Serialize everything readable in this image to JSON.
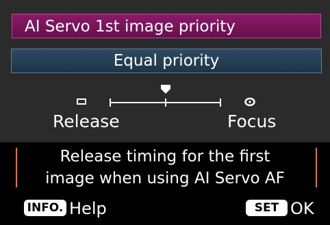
{
  "menu": {
    "title": "AI Servo 1st image priority",
    "selected_value": "Equal priority"
  },
  "slider": {
    "left_label": "Release",
    "right_label": "Focus",
    "left_icon": "release-square-icon",
    "right_icon": "focus-dot-icon",
    "pointer_icon": "pointer-down-icon",
    "position_fraction": 0.5
  },
  "description": {
    "line1": "Release timing for the first",
    "line2": "image when using AI Servo AF"
  },
  "footer": {
    "info_key": "INFO.",
    "info_label": "Help",
    "set_key": "SET",
    "set_label": "OK"
  },
  "colors": {
    "title_bar": "#7a1259",
    "value_bar": "#264058",
    "accent_bracket": "#e07a1f",
    "panel": "#2b2b2b"
  }
}
